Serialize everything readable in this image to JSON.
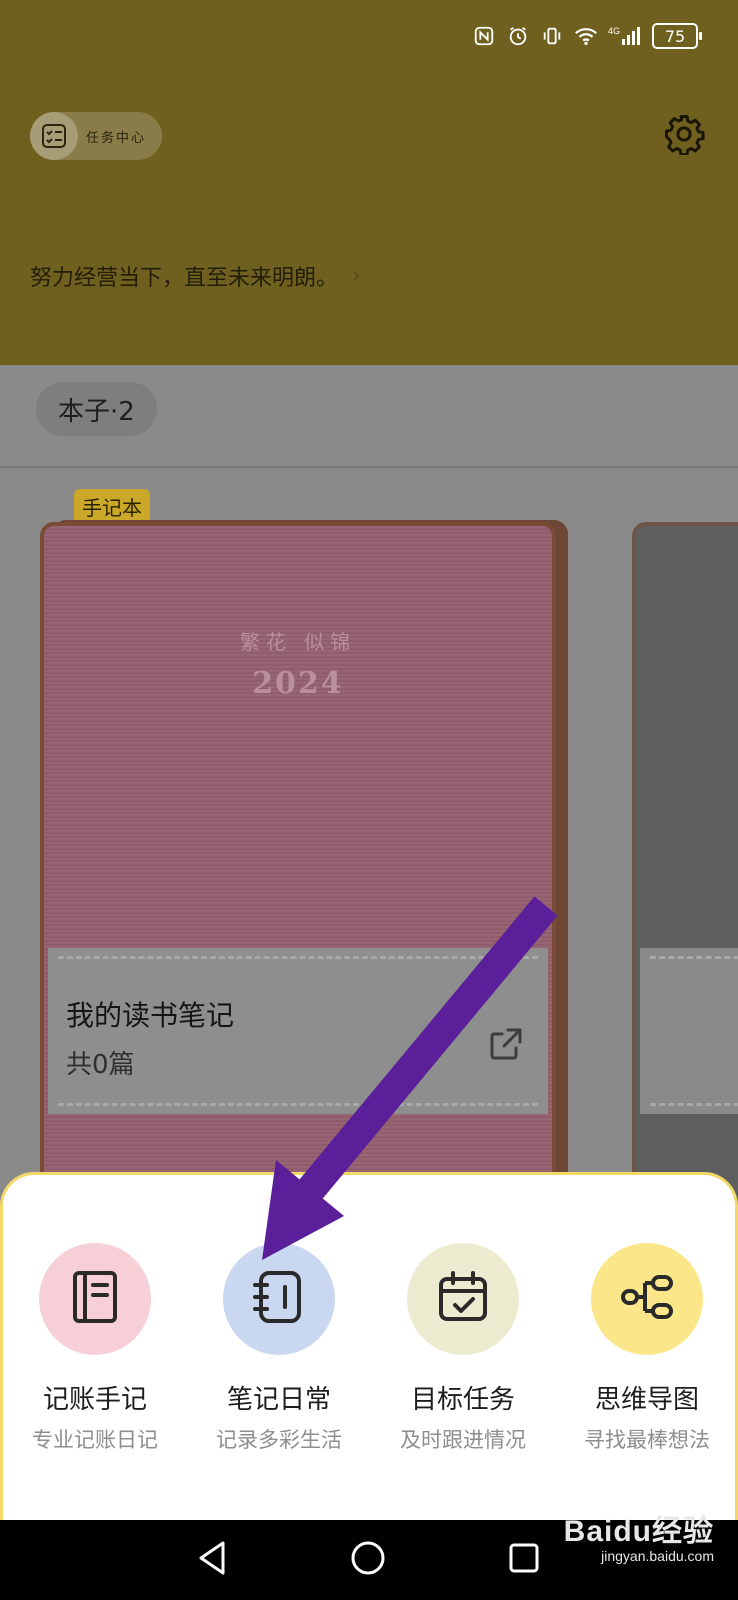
{
  "status_bar": {
    "battery": "75",
    "network": "4G"
  },
  "header": {
    "task_center_label": "任务中心",
    "motto": "努力经营当下，直至未来明朗。"
  },
  "tabs": {
    "books_label": "本子·2"
  },
  "notebook": {
    "tag": "手记本",
    "cover_motto": "繁花 似锦",
    "cover_year": "2024",
    "title": "我的读书笔记",
    "count": "共0篇"
  },
  "actions": [
    {
      "title": "记账手记",
      "subtitle": "专业记账日记",
      "icon": "ledger-book-icon",
      "color": "#f6d0d6"
    },
    {
      "title": "笔记日常",
      "subtitle": "记录多彩生活",
      "icon": "notebook-icon",
      "color": "#c9d8f0"
    },
    {
      "title": "目标任务",
      "subtitle": "及时跟进情况",
      "icon": "calendar-check-icon",
      "color": "#ecebcf"
    },
    {
      "title": "思维导图",
      "subtitle": "寻找最棒想法",
      "icon": "mind-map-icon",
      "color": "#fbe78a"
    }
  ],
  "watermark": {
    "brand": "Baidu经验",
    "url": "jingyan.baidu.com"
  },
  "colors": {
    "accent_purple": "#5b1f9a",
    "sheet_border": "#f2d76a"
  }
}
